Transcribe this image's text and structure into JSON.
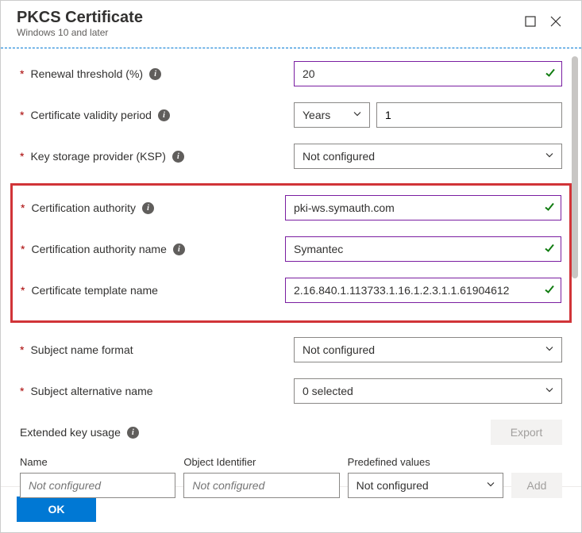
{
  "header": {
    "title": "PKCS Certificate",
    "subtitle": "Windows 10 and later"
  },
  "fields": {
    "renewal": {
      "label": "Renewal threshold (%)",
      "value": "20"
    },
    "validity": {
      "label": "Certificate validity period",
      "unit": "Years",
      "value": "1"
    },
    "ksp": {
      "label": "Key storage provider (KSP)",
      "value": "Not configured"
    },
    "ca": {
      "label": "Certification authority",
      "value": "pki-ws.symauth.com"
    },
    "caName": {
      "label": "Certification authority name",
      "value": "Symantec"
    },
    "template": {
      "label": "Certificate template name",
      "value": "2.16.840.1.113733.1.16.1.2.3.1.1.61904612"
    },
    "subjectFormat": {
      "label": "Subject name format",
      "value": "Not configured"
    },
    "san": {
      "label": "Subject alternative name",
      "value": "0 selected"
    }
  },
  "eku": {
    "label": "Extended key usage",
    "export_label": "Export",
    "add_label": "Add",
    "cols": {
      "name": {
        "header": "Name",
        "placeholder": "Not configured"
      },
      "oid": {
        "header": "Object Identifier",
        "placeholder": "Not configured"
      },
      "predef": {
        "header": "Predefined values",
        "value": "Not configured"
      }
    }
  },
  "footer": {
    "ok_label": "OK"
  }
}
